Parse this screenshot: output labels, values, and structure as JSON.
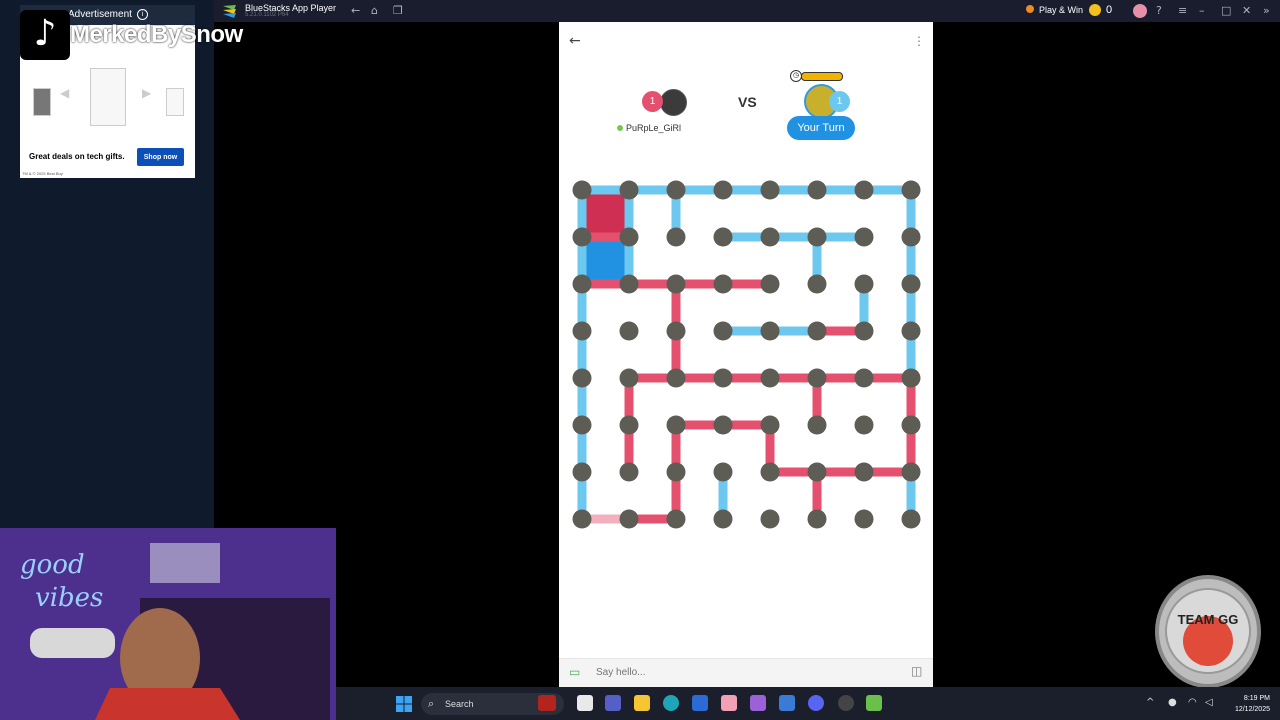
{
  "overlay": {
    "streamer_name": "MerkedBySnow",
    "ad_label": "Advertisement",
    "ad_headline": "Great deals on tech gifts.",
    "ad_button": "Shop now",
    "ad_legal": "TM & © 2025 Best Buy"
  },
  "titlebar": {
    "app_title": "BlueStacks App Player",
    "app_sub": "5.21.0.1102 P64",
    "play_win": "Play & Win",
    "coin_count": "0"
  },
  "game": {
    "player1": {
      "name": "PuRpLe_GiRl",
      "score": "1",
      "color": "#e5506f"
    },
    "player2": {
      "score": "1",
      "turn_label": "Your Turn",
      "color": "#6cc8ee"
    },
    "vs_label": "VS",
    "chat_placeholder": "Say hello..."
  },
  "board": {
    "cols": 8,
    "rows": 8,
    "dot_color": "#5d5c55",
    "blue": "#6cc8ee",
    "red": "#e5506f",
    "boxes": [
      {
        "row": 0,
        "col": 0,
        "owner": "red"
      },
      {
        "row": 1,
        "col": 0,
        "owner": "blue"
      }
    ],
    "blue_edges": [
      [
        0,
        0,
        0,
        1
      ],
      [
        0,
        1,
        0,
        2
      ],
      [
        0,
        2,
        0,
        3
      ],
      [
        0,
        3,
        0,
        4
      ],
      [
        0,
        4,
        0,
        5
      ],
      [
        0,
        5,
        0,
        6
      ],
      [
        0,
        6,
        0,
        7
      ],
      [
        0,
        0,
        1,
        0
      ],
      [
        0,
        1,
        1,
        1
      ],
      [
        0,
        2,
        1,
        2
      ],
      [
        0,
        7,
        1,
        7
      ],
      [
        1,
        3,
        1,
        4
      ],
      [
        1,
        4,
        1,
        5
      ],
      [
        1,
        5,
        1,
        6
      ],
      [
        1,
        0,
        2,
        0
      ],
      [
        1,
        1,
        2,
        1
      ],
      [
        1,
        5,
        2,
        5
      ],
      [
        1,
        7,
        2,
        7
      ],
      [
        2,
        0,
        3,
        0
      ],
      [
        2,
        6,
        3,
        6
      ],
      [
        2,
        7,
        3,
        7
      ],
      [
        3,
        3,
        3,
        4
      ],
      [
        3,
        4,
        3,
        5
      ],
      [
        3,
        0,
        4,
        0
      ],
      [
        3,
        7,
        4,
        7
      ],
      [
        4,
        0,
        5,
        0
      ],
      [
        5,
        0,
        6,
        0
      ],
      [
        6,
        0,
        7,
        0
      ],
      [
        6,
        3,
        7,
        3
      ],
      [
        6,
        7,
        7,
        7
      ]
    ],
    "red_edges": [
      [
        1,
        0,
        1,
        1
      ],
      [
        2,
        0,
        2,
        1
      ],
      [
        2,
        1,
        2,
        2
      ],
      [
        2,
        2,
        2,
        3
      ],
      [
        2,
        3,
        2,
        4
      ],
      [
        2,
        2,
        3,
        2
      ],
      [
        3,
        2,
        4,
        2
      ],
      [
        3,
        5,
        3,
        6
      ],
      [
        4,
        1,
        4,
        2
      ],
      [
        4,
        2,
        4,
        3
      ],
      [
        4,
        3,
        4,
        4
      ],
      [
        4,
        4,
        4,
        5
      ],
      [
        4,
        5,
        4,
        6
      ],
      [
        4,
        6,
        4,
        7
      ],
      [
        4,
        1,
        5,
        1
      ],
      [
        4,
        5,
        5,
        5
      ],
      [
        4,
        7,
        5,
        7
      ],
      [
        5,
        2,
        5,
        3
      ],
      [
        5,
        3,
        5,
        4
      ],
      [
        5,
        1,
        6,
        1
      ],
      [
        5,
        2,
        6,
        2
      ],
      [
        5,
        4,
        6,
        4
      ],
      [
        5,
        7,
        6,
        7
      ],
      [
        6,
        4,
        6,
        5
      ],
      [
        6,
        5,
        6,
        6
      ],
      [
        6,
        6,
        6,
        7
      ],
      [
        6,
        2,
        7,
        2
      ],
      [
        6,
        5,
        7,
        5
      ],
      [
        7,
        1,
        7,
        2
      ]
    ],
    "last_move": [
      7,
      0,
      7,
      1
    ]
  },
  "taskbar": {
    "search_label": "Search",
    "time": "8:19 PM",
    "date": "12/12/2025"
  },
  "team_logo_text": "TEAM GG"
}
